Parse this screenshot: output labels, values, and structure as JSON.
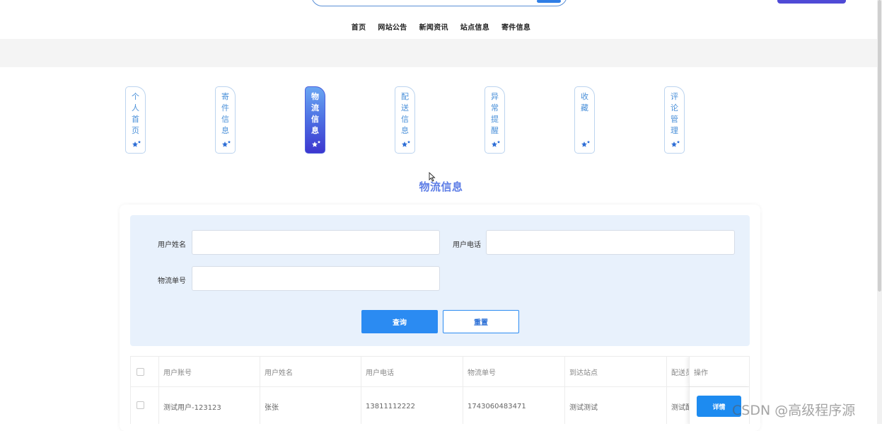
{
  "header": {
    "nav": [
      "首页",
      "网站公告",
      "新闻资讯",
      "站点信息",
      "寄件信息"
    ]
  },
  "tabs": [
    {
      "label": "个人首页",
      "chars": [
        "个",
        "人",
        "首",
        "页"
      ],
      "active": false
    },
    {
      "label": "寄件信息",
      "chars": [
        "寄",
        "件",
        "信",
        "息"
      ],
      "active": false
    },
    {
      "label": "物流信息",
      "chars": [
        "物",
        "流",
        "信",
        "息"
      ],
      "active": true
    },
    {
      "label": "配送信息",
      "chars": [
        "配",
        "送",
        "信",
        "息"
      ],
      "active": false
    },
    {
      "label": "异常提醒",
      "chars": [
        "异",
        "常",
        "提",
        "醒"
      ],
      "active": false
    },
    {
      "label": "收藏",
      "chars": [
        "收",
        "藏"
      ],
      "active": false
    },
    {
      "label": "评论管理",
      "chars": [
        "评",
        "论",
        "管",
        "理"
      ],
      "active": false
    }
  ],
  "page_title": "物流信息",
  "filter": {
    "user_name_label": "用户姓名",
    "user_name_value": "",
    "user_phone_label": "用户电话",
    "user_phone_value": "",
    "tracking_label": "物流单号",
    "tracking_value": "",
    "query_label": "查询",
    "reset_label": "重置"
  },
  "table": {
    "columns": [
      "用户账号",
      "用户姓名",
      "用户电话",
      "物流单号",
      "到达站点",
      "配送员",
      "操作"
    ],
    "rows": [
      {
        "account": "测试用户-123123",
        "name": "张张",
        "phone": "13811112222",
        "tracking": "1743060483471",
        "station": "测试测试",
        "courier": "测试配",
        "action": "详情"
      }
    ]
  },
  "watermark": "CSDN @高级程序源",
  "colors": {
    "accent": "#2b8bf2",
    "active_tab_top": "#6aa6f2",
    "active_tab_bottom": "#3d36cf",
    "title": "#5e7ee6"
  }
}
